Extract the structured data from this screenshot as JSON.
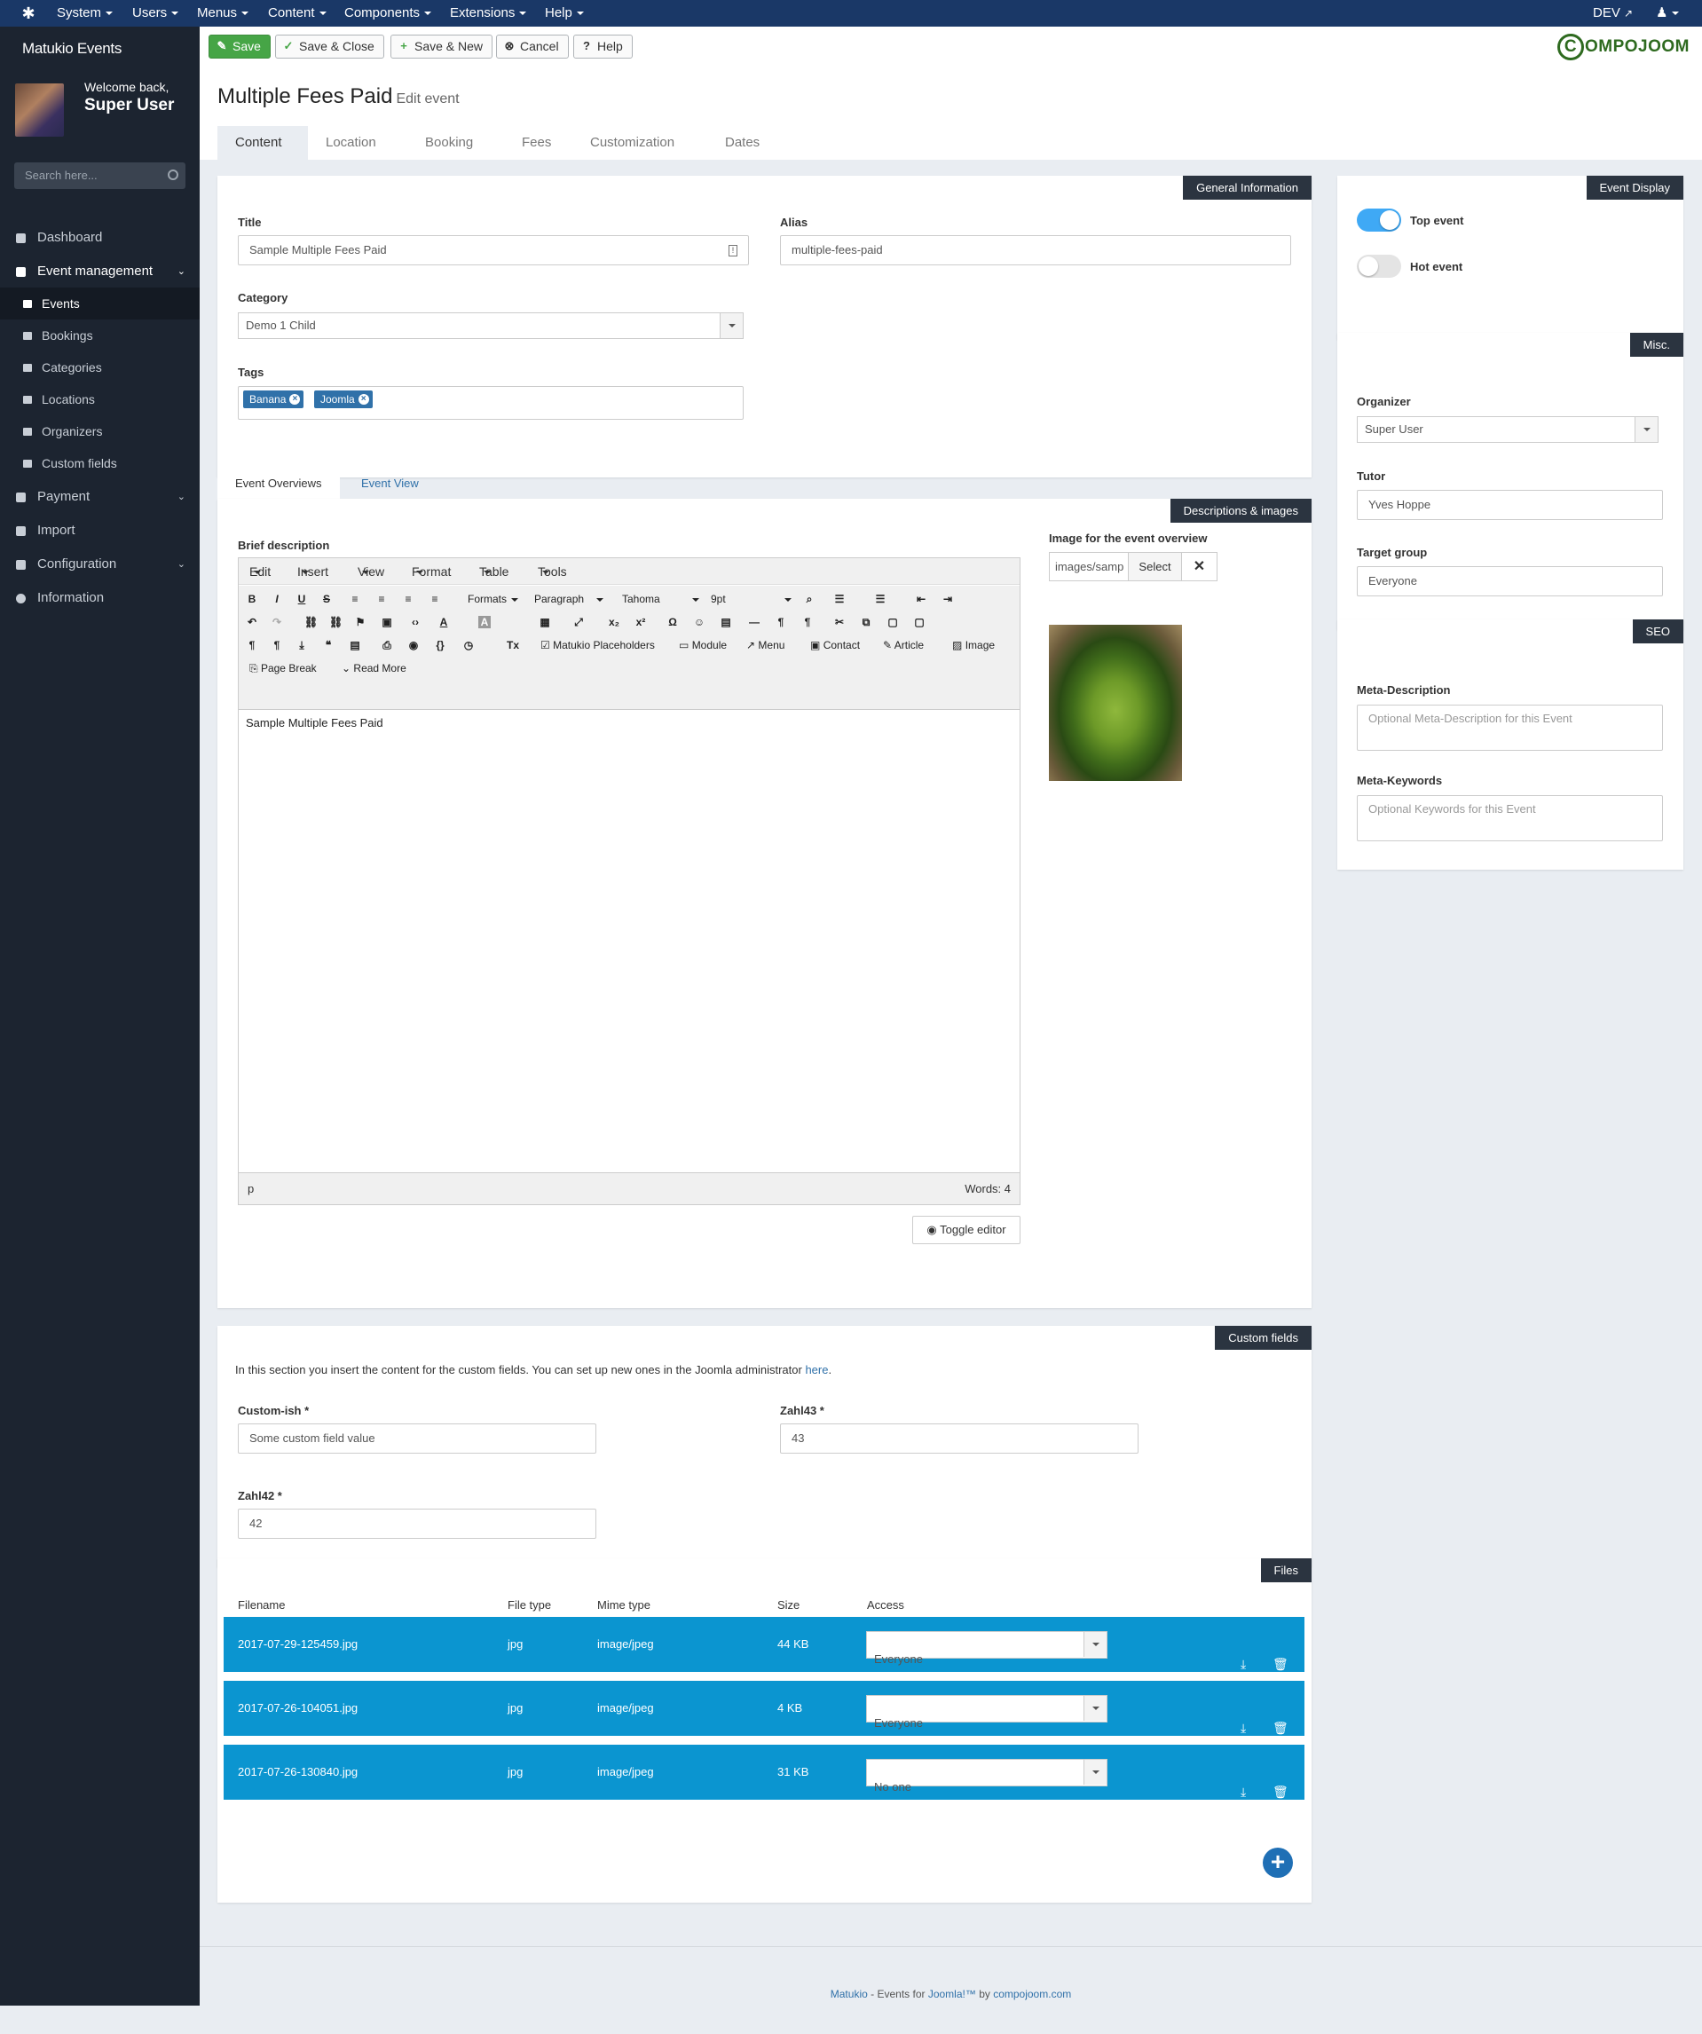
{
  "topbar": {
    "menu": [
      "System",
      "Users",
      "Menus",
      "Content",
      "Components",
      "Extensions",
      "Help"
    ],
    "site_label": "DEV"
  },
  "sidebar": {
    "brand": "Matukio Events",
    "welcome": "Welcome back,",
    "user": "Super User",
    "search_placeholder": "Search here...",
    "items": [
      {
        "label": "Dashboard",
        "icon": "dashboard-icon"
      },
      {
        "label": "Event management",
        "icon": "briefcase-icon"
      },
      {
        "label": "Payment",
        "icon": "money-icon"
      },
      {
        "label": "Import",
        "icon": "download-icon"
      },
      {
        "label": "Configuration",
        "icon": "wrench-icon"
      },
      {
        "label": "Information",
        "icon": "info-icon"
      }
    ],
    "subitems": [
      "Events",
      "Bookings",
      "Categories",
      "Locations",
      "Organizers",
      "Custom fields"
    ]
  },
  "toolbar": {
    "save": "Save",
    "save_close": "Save & Close",
    "save_new": "Save & New",
    "cancel": "Cancel",
    "help": "Help",
    "logo_rest": "OMPOJOOM",
    "logo_letter": "C"
  },
  "page": {
    "title": "Multiple Fees Paid",
    "subtitle": "Edit event",
    "tabs": [
      "Content",
      "Location",
      "Booking",
      "Fees",
      "Customization",
      "Dates"
    ]
  },
  "general": {
    "label": "General Information",
    "title_label": "Title",
    "title_value": "Sample Multiple Fees Paid",
    "alias_label": "Alias",
    "alias_value": "multiple-fees-paid",
    "category_label": "Category",
    "category_value": "Demo 1 Child",
    "tags_label": "Tags",
    "tags": [
      "Banana",
      "Joomla"
    ]
  },
  "display": {
    "label": "Event Display",
    "top_event": "Top event",
    "hot_event": "Hot event"
  },
  "misc": {
    "label": "Misc.",
    "organizer_label": "Organizer",
    "organizer_value": "Super User",
    "tutor_label": "Tutor",
    "tutor_value": "Yves Hoppe",
    "target_label": "Target group",
    "target_value": "Everyone"
  },
  "seo": {
    "label": "SEO",
    "meta_desc_label": "Meta-Description",
    "meta_desc_placeholder": "Optional Meta-Description for this Event",
    "meta_kw_label": "Meta-Keywords",
    "meta_kw_placeholder": "Optional Keywords for this Event"
  },
  "desc": {
    "subtabs": [
      "Event Overviews",
      "Event View"
    ],
    "label": "Descriptions & images",
    "brief_label": "Brief description",
    "editor_menu": [
      "Edit",
      "Insert",
      "View",
      "Format",
      "Table",
      "Tools"
    ],
    "formats": "Formats",
    "paragraph": "Paragraph",
    "font": "Tahoma",
    "size": "9pt",
    "placeholders": "Matukio Placeholders",
    "module": "Module",
    "menu": "Menu",
    "contact": "Contact",
    "article": "Article",
    "image": "Image",
    "page_break": "Page Break",
    "read_more": "Read More",
    "content": "Sample Multiple Fees Paid",
    "status_path": "p",
    "words": "Words: 4",
    "toggle": "Toggle editor",
    "image_label": "Image for the event overview",
    "image_path": "images/samp",
    "select": "Select"
  },
  "custom": {
    "label": "Custom fields",
    "intro": "In this section you insert the content for the custom fields. You can set up new ones in the Joomla administrator",
    "intro_link": "here",
    "fields": [
      {
        "label": "Custom-ish *",
        "value": "Some custom field value"
      },
      {
        "label": "Zahl43 *",
        "value": "43"
      },
      {
        "label": "Zahl42 *",
        "value": "42"
      }
    ]
  },
  "files": {
    "label": "Files",
    "headers": [
      "Filename",
      "File type",
      "Mime type",
      "Size",
      "Access"
    ],
    "rows": [
      {
        "name": "2017-07-29-125459.jpg",
        "type": "jpg",
        "mime": "image/jpeg",
        "size": "44 KB",
        "access": "Everyone"
      },
      {
        "name": "2017-07-26-104051.jpg",
        "type": "jpg",
        "mime": "image/jpeg",
        "size": "4 KB",
        "access": "Everyone"
      },
      {
        "name": "2017-07-26-130840.jpg",
        "type": "jpg",
        "mime": "image/jpeg",
        "size": "31 KB",
        "access": "No one"
      }
    ]
  },
  "footer": {
    "matukio": "Matukio",
    "mid": " - Events for ",
    "joomla": "Joomla!™",
    "by": " by ",
    "site": "compojoom.com"
  },
  "colors": {
    "topbar": "#1a3867",
    "sidebar": "#1c2430",
    "file_row": "#0b95d0",
    "save": "#46a546"
  }
}
